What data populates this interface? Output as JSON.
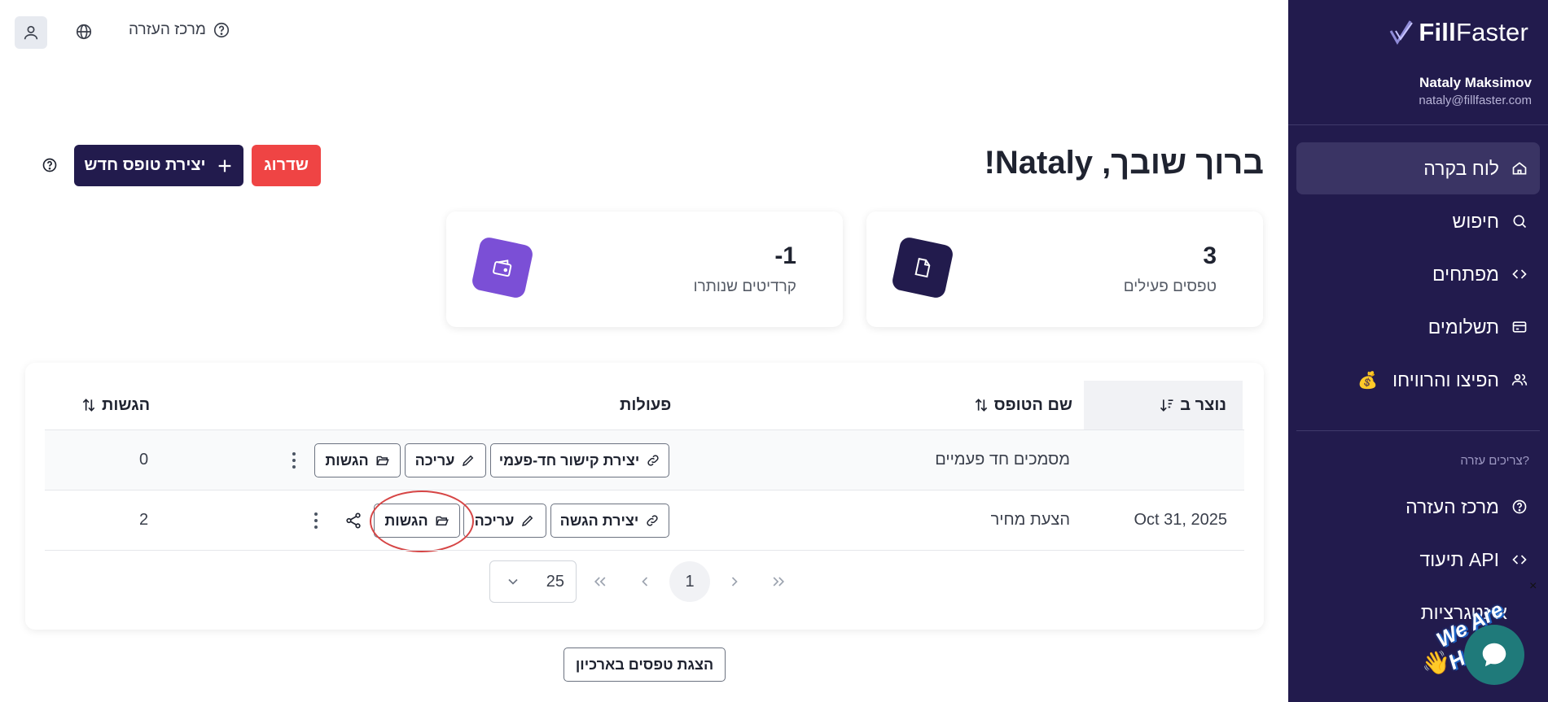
{
  "topbar": {
    "help_center": "מרכז העזרה"
  },
  "sidebar": {
    "logo_fill": "Fill",
    "logo_faster": "Faster",
    "user_name": "Nataly Maksimov",
    "user_email": "nataly@fillfaster.com",
    "items": [
      {
        "label": "לוח בקרה",
        "icon": "home-icon",
        "active": true
      },
      {
        "label": "חיפוש",
        "icon": "search-icon"
      },
      {
        "label": "מפתחים",
        "icon": "code-icon"
      },
      {
        "label": "תשלומים",
        "icon": "credit-card-icon"
      },
      {
        "label": "הפיצו והרוויחו",
        "icon": "users-icon",
        "emoji": "💰"
      }
    ],
    "help_heading": "צריכים עזרה?",
    "help_items": [
      {
        "label": "מרכז העזרה",
        "icon": "help-circle-icon"
      },
      {
        "label": "תיעוד API",
        "icon": "code-icon"
      },
      {
        "label": "אינטגרציות",
        "icon": "plug-icon"
      }
    ]
  },
  "header": {
    "welcome": "ברוך שובך, Nataly!",
    "new_form": "יצירת טופס חדש",
    "upgrade": "שדרוג"
  },
  "stats": [
    {
      "value": "3",
      "label": "טפסים פעילים",
      "icon": "file-icon"
    },
    {
      "value": "-1",
      "label": "קרדיטים שנותרו",
      "icon": "wallet-icon"
    }
  ],
  "table": {
    "headers": {
      "created": "נוצר ב",
      "name": "שם הטופס",
      "actions": "פעולות",
      "submissions": "הגשות"
    },
    "rows": [
      {
        "created": "",
        "name": "מסמכים חד פעמיים",
        "btn_create": "יצירת קישור חד-פעמי",
        "btn_edit": "עריכה",
        "btn_subs": "הגשות",
        "submissions": "0"
      },
      {
        "created": "Oct 31, 2025",
        "name": "הצעת מחיר",
        "btn_create": "יצירת הגשה",
        "btn_edit": "עריכה",
        "btn_subs": "הגשות",
        "submissions": "2"
      }
    ],
    "pagination": {
      "page_size": "25",
      "current_page": "1"
    }
  },
  "archive_button": "הצגת טפסים בארכיון",
  "chat": {
    "badge": "We Are Here!",
    "close": "×"
  },
  "colors": {
    "sidebar_bg": "#221b4d",
    "accent_purple": "#7b4fd6",
    "upgrade_red": "#ef4444",
    "chat_teal": "#1f7a7a"
  }
}
